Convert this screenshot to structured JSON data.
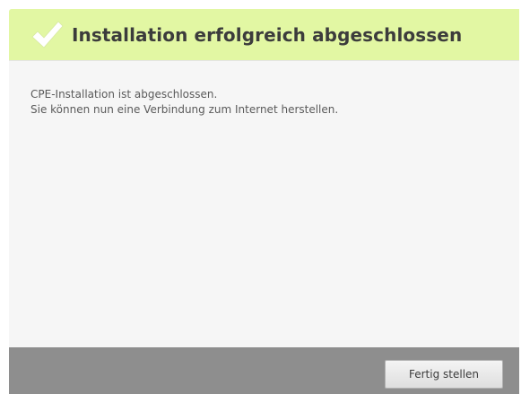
{
  "dialog": {
    "header": {
      "title": "Installation erfolgreich abgeschlossen",
      "icon": "checkmark-icon",
      "background_color": "#e2f7a3"
    },
    "message": {
      "line1": "CPE-Installation ist abgeschlossen.",
      "line2": "Sie können nun eine Verbindung zum Internet herstellen."
    },
    "footer": {
      "finish_label": "Fertig stellen",
      "background_color": "#8e8e8e"
    }
  }
}
